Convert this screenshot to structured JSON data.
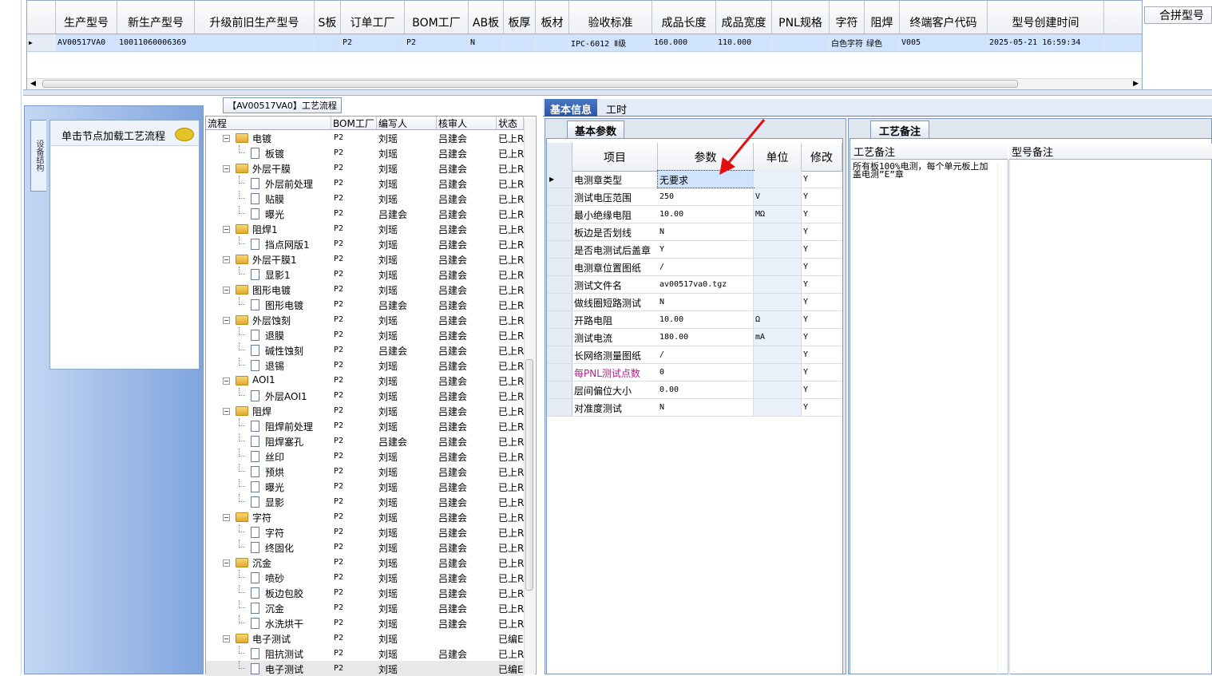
{
  "top_grid": {
    "headers": [
      "生产型号",
      "新生产型号",
      "升级前旧生产型号",
      "S板",
      "订单工厂",
      "BOM工厂",
      "AB板",
      "板厚",
      "板材",
      "验收标准",
      "成品长度",
      "成品宽度",
      "PNL规格",
      "字符",
      "阻焊",
      "终端客户代码",
      "型号创建时间"
    ],
    "merge_header": "合拼型号",
    "row": [
      "AV00517VA0",
      "10011060006369",
      "",
      "",
      "P2",
      "P2",
      "N",
      "",
      "",
      "IPC-6012 Ⅱ级",
      "160.000",
      "110.000",
      "",
      "白色字符",
      "绿色",
      "V005",
      "2025-05-21 16:59:34"
    ]
  },
  "left_panel": {
    "vertical_tab": "设备结构",
    "hint": "单击节点加载工艺流程"
  },
  "process": {
    "tab_title": "【AV00517VA0】工艺流程",
    "headers": [
      "流程",
      "BOM工厂",
      "编写人",
      "核审人",
      "状态"
    ],
    "rows": [
      {
        "name": "电镀",
        "level": 0,
        "bom": "P2",
        "writer": "刘瑶",
        "reviewer": "吕建会",
        "status": "已上R"
      },
      {
        "name": "板镀",
        "level": 1,
        "bom": "P2",
        "writer": "刘瑶",
        "reviewer": "吕建会",
        "status": "已上R"
      },
      {
        "name": "外层干膜",
        "level": 0,
        "bom": "P2",
        "writer": "刘瑶",
        "reviewer": "吕建会",
        "status": "已上R"
      },
      {
        "name": "外层前处理",
        "level": 1,
        "bom": "P2",
        "writer": "刘瑶",
        "reviewer": "吕建会",
        "status": "已上R"
      },
      {
        "name": "贴膜",
        "level": 1,
        "bom": "P2",
        "writer": "刘瑶",
        "reviewer": "吕建会",
        "status": "已上R"
      },
      {
        "name": "曝光",
        "level": 1,
        "bom": "P2",
        "writer": "吕建会",
        "reviewer": "吕建会",
        "status": "已上R"
      },
      {
        "name": "阻焊1",
        "level": 0,
        "bom": "P2",
        "writer": "刘瑶",
        "reviewer": "吕建会",
        "status": "已上R"
      },
      {
        "name": "挡点网版1",
        "level": 1,
        "bom": "P2",
        "writer": "刘瑶",
        "reviewer": "吕建会",
        "status": "已上R"
      },
      {
        "name": "外层干膜1",
        "level": 0,
        "bom": "P2",
        "writer": "刘瑶",
        "reviewer": "吕建会",
        "status": "已上R"
      },
      {
        "name": "显影1",
        "level": 1,
        "bom": "P2",
        "writer": "刘瑶",
        "reviewer": "吕建会",
        "status": "已上R"
      },
      {
        "name": "图形电镀",
        "level": 0,
        "bom": "P2",
        "writer": "刘瑶",
        "reviewer": "吕建会",
        "status": "已上R"
      },
      {
        "name": "图形电镀",
        "level": 1,
        "bom": "P2",
        "writer": "吕建会",
        "reviewer": "吕建会",
        "status": "已上R"
      },
      {
        "name": "外层蚀刻",
        "level": 0,
        "bom": "P2",
        "writer": "刘瑶",
        "reviewer": "吕建会",
        "status": "已上R"
      },
      {
        "name": "退膜",
        "level": 1,
        "bom": "P2",
        "writer": "刘瑶",
        "reviewer": "吕建会",
        "status": "已上R"
      },
      {
        "name": "碱性蚀刻",
        "level": 1,
        "bom": "P2",
        "writer": "吕建会",
        "reviewer": "吕建会",
        "status": "已上R"
      },
      {
        "name": "退锡",
        "level": 1,
        "bom": "P2",
        "writer": "刘瑶",
        "reviewer": "吕建会",
        "status": "已上R"
      },
      {
        "name": "AOI1",
        "level": 0,
        "bom": "P2",
        "writer": "刘瑶",
        "reviewer": "吕建会",
        "status": "已上R"
      },
      {
        "name": "外层AOI1",
        "level": 1,
        "bom": "P2",
        "writer": "刘瑶",
        "reviewer": "吕建会",
        "status": "已上R"
      },
      {
        "name": "阻焊",
        "level": 0,
        "bom": "P2",
        "writer": "刘瑶",
        "reviewer": "吕建会",
        "status": "已上R"
      },
      {
        "name": "阻焊前处理",
        "level": 1,
        "bom": "P2",
        "writer": "刘瑶",
        "reviewer": "吕建会",
        "status": "已上R"
      },
      {
        "name": "阻焊塞孔",
        "level": 1,
        "bom": "P2",
        "writer": "吕建会",
        "reviewer": "吕建会",
        "status": "已上R"
      },
      {
        "name": "丝印",
        "level": 1,
        "bom": "P2",
        "writer": "刘瑶",
        "reviewer": "吕建会",
        "status": "已上R"
      },
      {
        "name": "预烘",
        "level": 1,
        "bom": "P2",
        "writer": "刘瑶",
        "reviewer": "吕建会",
        "status": "已上R"
      },
      {
        "name": "曝光",
        "level": 1,
        "bom": "P2",
        "writer": "刘瑶",
        "reviewer": "吕建会",
        "status": "已上R"
      },
      {
        "name": "显影",
        "level": 1,
        "bom": "P2",
        "writer": "刘瑶",
        "reviewer": "吕建会",
        "status": "已上R"
      },
      {
        "name": "字符",
        "level": 0,
        "bom": "P2",
        "writer": "刘瑶",
        "reviewer": "吕建会",
        "status": "已上R"
      },
      {
        "name": "字符",
        "level": 1,
        "bom": "P2",
        "writer": "刘瑶",
        "reviewer": "吕建会",
        "status": "已上R"
      },
      {
        "name": "终固化",
        "level": 1,
        "bom": "P2",
        "writer": "刘瑶",
        "reviewer": "吕建会",
        "status": "已上R"
      },
      {
        "name": "沉金",
        "level": 0,
        "bom": "P2",
        "writer": "刘瑶",
        "reviewer": "吕建会",
        "status": "已上R"
      },
      {
        "name": "喷砂",
        "level": 1,
        "bom": "P2",
        "writer": "刘瑶",
        "reviewer": "吕建会",
        "status": "已上R"
      },
      {
        "name": "板边包胶",
        "level": 1,
        "bom": "P2",
        "writer": "刘瑶",
        "reviewer": "吕建会",
        "status": "已上R"
      },
      {
        "name": "沉金",
        "level": 1,
        "bom": "P2",
        "writer": "刘瑶",
        "reviewer": "吕建会",
        "status": "已上R"
      },
      {
        "name": "水洗烘干",
        "level": 1,
        "bom": "P2",
        "writer": "刘瑶",
        "reviewer": "吕建会",
        "status": "已上R"
      },
      {
        "name": "电子测试",
        "level": 0,
        "bom": "P2",
        "writer": "刘瑶",
        "reviewer": "",
        "status": "已编E"
      },
      {
        "name": "阻抗测试",
        "level": 1,
        "bom": "P2",
        "writer": "刘瑶",
        "reviewer": "吕建会",
        "status": "已上R"
      },
      {
        "name": "电子测试",
        "level": 1,
        "bom": "P2",
        "writer": "刘瑶",
        "reviewer": "",
        "status": "已编E"
      }
    ]
  },
  "right_tabs": [
    "基本信息",
    "工时"
  ],
  "params": {
    "tab": "基本参数",
    "headers": [
      "项目",
      "参数",
      "单位",
      "修改"
    ],
    "rows": [
      {
        "item": "电测章类型",
        "value": "无要求",
        "unit": "",
        "mod": "Y"
      },
      {
        "item": "测试电压范围",
        "value": "250",
        "unit": "V",
        "mod": "Y"
      },
      {
        "item": "最小绝缘电阻",
        "value": "10.00",
        "unit": "MΩ",
        "mod": "Y"
      },
      {
        "item": "板边是否划线",
        "value": "N",
        "unit": "",
        "mod": "Y"
      },
      {
        "item": "是否电测试后盖章",
        "value": "Y",
        "unit": "",
        "mod": "Y"
      },
      {
        "item": "电测章位置图纸",
        "value": "/",
        "unit": "",
        "mod": "Y"
      },
      {
        "item": "测试文件名",
        "value": "av00517va0.tgz",
        "unit": "",
        "mod": "Y"
      },
      {
        "item": "做线圈短路测试",
        "value": "N",
        "unit": "",
        "mod": "Y"
      },
      {
        "item": "开路电阻",
        "value": "10.00",
        "unit": "Ω",
        "mod": "Y"
      },
      {
        "item": "测试电流",
        "value": "180.00",
        "unit": "mA",
        "mod": "Y"
      },
      {
        "item": "长网络测量图纸",
        "value": "/",
        "unit": "",
        "mod": "Y"
      },
      {
        "item": "每PNL测试点数",
        "value": "0",
        "unit": "",
        "mod": "Y"
      },
      {
        "item": "层间偏位大小",
        "value": "0.00",
        "unit": "",
        "mod": "Y"
      },
      {
        "item": "对准度测试",
        "value": "N",
        "unit": "",
        "mod": "Y"
      }
    ]
  },
  "notes": {
    "tab": "工艺备注",
    "col1": "工艺备注",
    "col2": "型号备注",
    "text": "所有板100%电测，每个单元板上加盖电测”E”章"
  },
  "colors": {
    "accent": "#2a56a3",
    "selected_row": "#cfe3ff",
    "highlight_text": "#b0208a",
    "arrow": "#e01010"
  }
}
